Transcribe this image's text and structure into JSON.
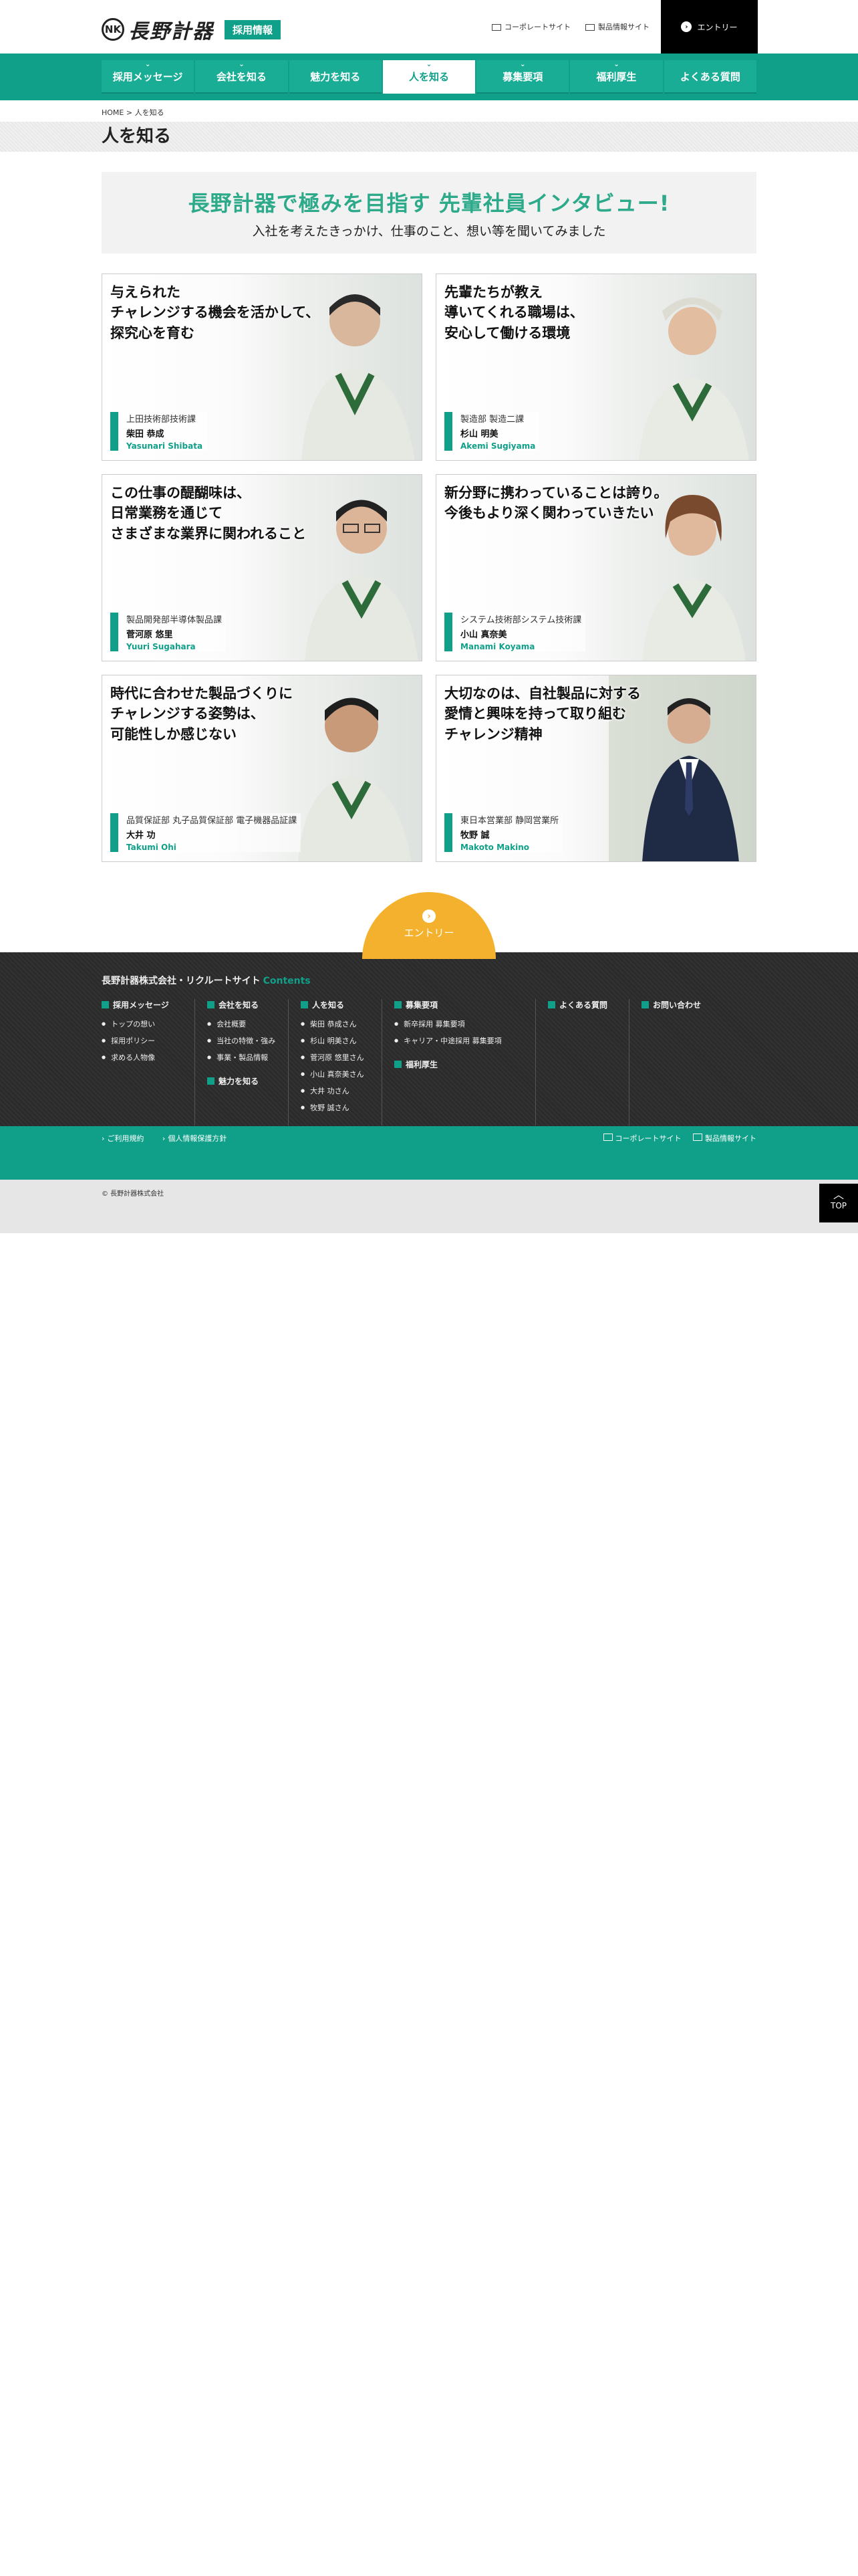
{
  "header": {
    "logo_mark": "NK",
    "logo_text": "長野計器",
    "recruit_label": "採用情報",
    "links": [
      "コーポレートサイト",
      "製品情報サイト"
    ],
    "entry_label": "エントリー"
  },
  "nav": {
    "items": [
      {
        "label": "採用メッセージ"
      },
      {
        "label": "会社を知る"
      },
      {
        "label": "魅力を知る"
      },
      {
        "label": "人を知る"
      },
      {
        "label": "募集要項"
      },
      {
        "label": "福利厚生"
      },
      {
        "label": "よくある質問"
      }
    ]
  },
  "breadcrumb": {
    "home": "HOME",
    "sep": ">",
    "current": "人を知る"
  },
  "page": {
    "title": "人を知る"
  },
  "banner": {
    "headline": "長野計器で極みを目指す 先輩社員インタビュー!",
    "sub": "入社を考えたきっかけ、仕事のこと、想い等を聞いてみました"
  },
  "cards": [
    {
      "quote": "与えられた\nチャレンジする機会を活かして、\n探究心を育む",
      "dept": "上田技術部技術課",
      "name": "柴田 恭成",
      "roman": "Yasunari Shibata"
    },
    {
      "quote": "先輩たちが教え\n導いてくれる職場は、\n安心して働ける環境",
      "dept": "製造部 製造二課",
      "name": "杉山 明美",
      "roman": "Akemi Sugiyama"
    },
    {
      "quote": "この仕事の醍醐味は、\n日常業務を通じて\nさまざまな業界に関われること",
      "dept": "製品開発部半導体製品課",
      "name": "菅河原 悠里",
      "roman": "Yuuri Sugahara"
    },
    {
      "quote": "新分野に携わっていることは誇り。\n今後もより深く関わっていきたい",
      "dept": "システム技術部システム技術課",
      "name": "小山 真奈美",
      "roman": "Manami Koyama"
    },
    {
      "quote": "時代に合わせた製品づくりに\nチャレンジする姿勢は、\n可能性しか感じない",
      "dept": "品質保証部 丸子品質保証部 電子機器品証課",
      "name": "大井 功",
      "roman": "Takumi Ohi"
    },
    {
      "quote": "大切なのは、自社製品に対する\n愛情と興味を持って取り組む\nチャレンジ精神",
      "dept": "東日本営業部 静岡営業所",
      "name": "牧野 誠",
      "roman": "Makoto Makino"
    }
  ],
  "entry_tab": {
    "label": "エントリー"
  },
  "footer": {
    "title": "長野計器株式会社・リクルートサイト",
    "title_accent": "Contents",
    "col1": {
      "head": "採用メッセージ",
      "items": [
        "トップの想い",
        "採用ポリシー",
        "求める人物像"
      ]
    },
    "col2": {
      "head": "会社を知る",
      "items": [
        "会社概要",
        "当社の特徴・強み",
        "事業・製品情報"
      ],
      "head2": "魅力を知る"
    },
    "col3": {
      "head": "人を知る",
      "items": [
        "柴田 恭成さん",
        "杉山 明美さん",
        "菅河原 悠里さん",
        "小山 真奈美さん",
        "大井 功さん",
        "牧野 誠さん"
      ]
    },
    "col4": {
      "head": "募集要項",
      "items": [
        "新卒採用 募集要項",
        "キャリア・中途採用 募集要項"
      ],
      "head2": "福利厚生"
    },
    "col5": {
      "head": "よくある質問"
    },
    "col6": {
      "head": "お問い合わせ"
    },
    "bottom_links": [
      "ご利用規約",
      "個人情報保護方針"
    ],
    "site_links": [
      "コーポレートサイト",
      "製品情報サイト"
    ],
    "copyright": "© 長野計器株式会社"
  },
  "top_button": {
    "label": "TOP"
  },
  "colors": {
    "brand": "#10a08a",
    "accent": "#f4b12e",
    "banner_text": "#2daa8a"
  }
}
